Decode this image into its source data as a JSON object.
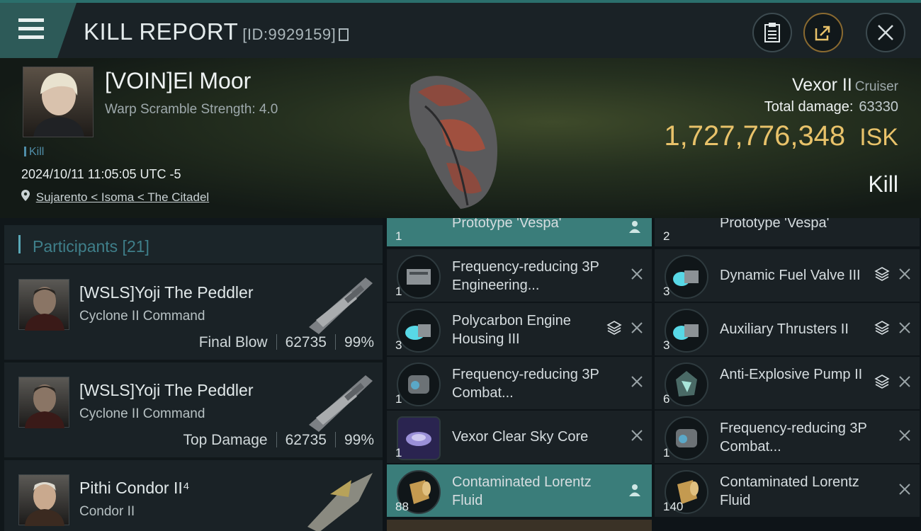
{
  "header": {
    "title": "KILL REPORT",
    "id_text": "[ID:9929159]"
  },
  "victim": {
    "pilot": "[VOIN]El Moor",
    "warp_scramble": "Warp Scramble Strength: 4.0",
    "tag": "Kill",
    "datetime": "2024/10/11 11:05:05 UTC -5",
    "location": "Sujarento < Isoma < The Citadel",
    "ship_name": "Vexor II",
    "ship_class": "Cruiser",
    "damage_label": "Total damage:",
    "damage_value": "63330",
    "isk_value": "1,727,776,348",
    "isk_unit": "ISK",
    "outcome": "Kill"
  },
  "participants": {
    "title": "Participants [21]",
    "rows": [
      {
        "name": "[WSLS]Yoji The Peddler",
        "ship": "Cyclone II Command",
        "role": "Final Blow",
        "damage": "62735",
        "percent": "99%"
      },
      {
        "name": "[WSLS]Yoji The Peddler",
        "ship": "Cyclone II Command",
        "role": "Top Damage",
        "damage": "62735",
        "percent": "99%"
      },
      {
        "name": "Pithi Condor II⁴",
        "ship": "Condor II"
      }
    ]
  },
  "items_left": [
    {
      "qty": "1",
      "name": "Prototype 'Vespa'"
    },
    {
      "qty": "1",
      "name": "Frequency-reducing 3P Engineering..."
    },
    {
      "qty": "3",
      "name": "Polycarbon Engine Housing III"
    },
    {
      "qty": "1",
      "name": "Frequency-reducing 3P Combat..."
    },
    {
      "qty": "1",
      "name": "Vexor Clear Sky Core"
    },
    {
      "qty": "88",
      "name": "Contaminated Lorentz Fluid"
    }
  ],
  "items_right": [
    {
      "qty": "2",
      "name": "Prototype 'Vespa'"
    },
    {
      "qty": "3",
      "name": "Dynamic Fuel Valve III"
    },
    {
      "qty": "3",
      "name": "Auxiliary Thrusters II"
    },
    {
      "qty": "6",
      "name": "Anti-Explosive Pump II"
    },
    {
      "qty": "1",
      "name": "Frequency-reducing 3P Combat..."
    },
    {
      "qty": "140",
      "name": "Contaminated Lorentz Fluid"
    }
  ],
  "colors": {
    "accent": "#3a7d7a",
    "isk": "#e8c26a",
    "participants_title": "#3f7f8a"
  }
}
